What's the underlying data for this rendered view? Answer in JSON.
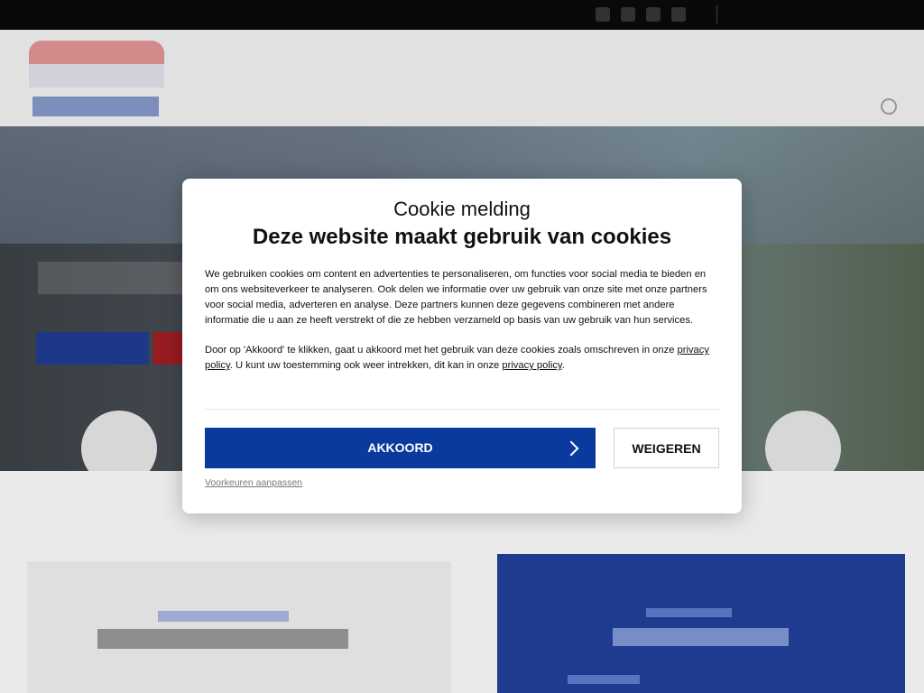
{
  "modal": {
    "kicker": "Cookie melding",
    "title": "Deze website maakt gebruik van cookies",
    "paragraph1": "We gebruiken cookies om content en advertenties te personaliseren, om functies voor social media te bieden en om ons websiteverkeer te analyseren. Ook delen we informatie over uw gebruik van onze site met onze partners voor social media, adverteren en analyse. Deze partners kunnen deze gegevens combineren met andere informatie die u aan ze heeft verstrekt of die ze hebben verzameld op basis van uw gebruik van hun services.",
    "paragraph2_part1": "Door op 'Akkoord' te klikken, gaat u akkoord met het gebruik van deze cookies zoals omschreven in onze ",
    "privacy_link_1": "privacy policy",
    "paragraph2_part2": ". U kunt uw toestemming ook weer intrekken, dit kan in onze ",
    "privacy_link_2": "privacy policy",
    "paragraph2_part3": ".",
    "accept_label": "AKKOORD",
    "reject_label": "WEIGEREN",
    "preferences_label": "Voorkeuren aanpassen"
  },
  "colors": {
    "accent": "#0a3a9d",
    "topbar": "#0a0a0a"
  }
}
